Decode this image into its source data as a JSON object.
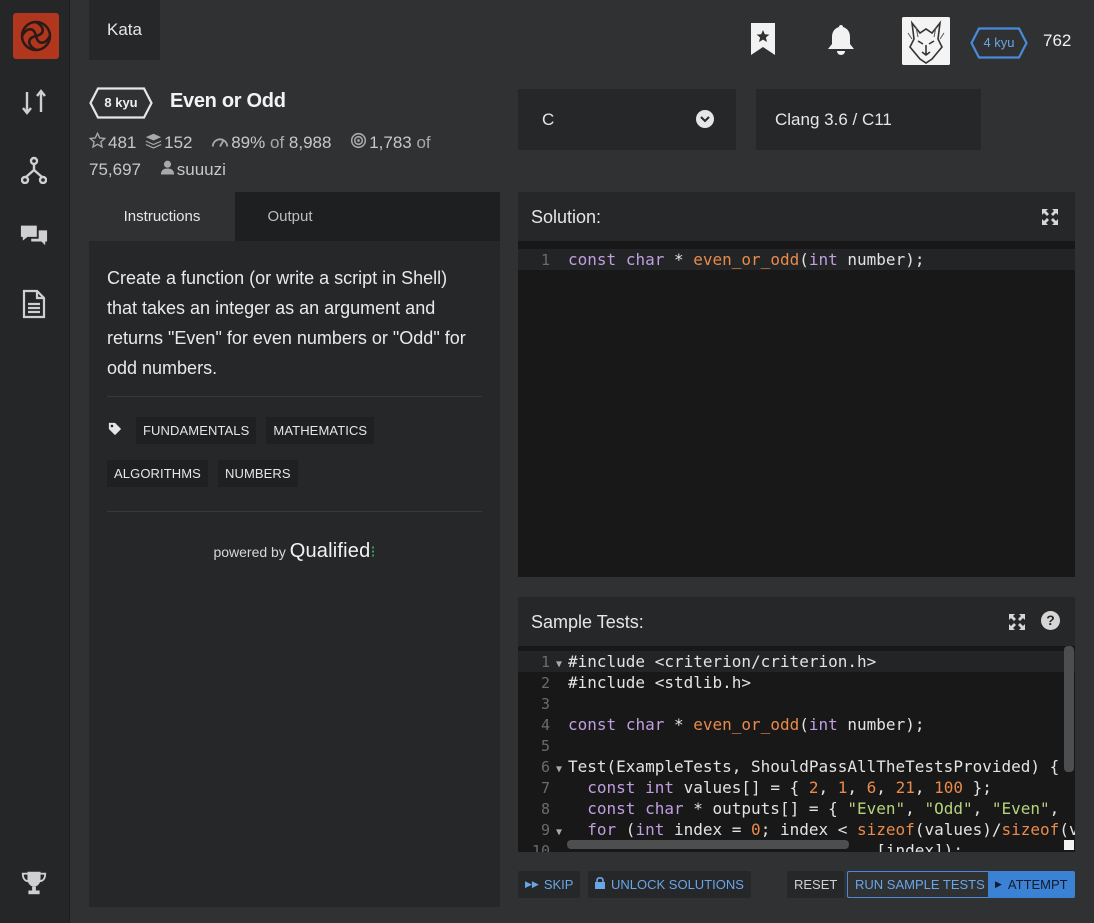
{
  "app": {
    "accent": "#b1361e",
    "link_color": "#6aa5e6"
  },
  "nav": {
    "top_tab": "Kata",
    "rail_icons": [
      "codewars-logo",
      "swap-arrows-icon",
      "fork-icon",
      "chat-icon",
      "document-icon",
      "trophy-icon"
    ]
  },
  "user": {
    "rank": "4 kyu",
    "honor": "762"
  },
  "kata": {
    "rank": "8 kyu",
    "title": "Even or Odd",
    "stars": "481",
    "collections": "152",
    "satisfaction_pct": "89%",
    "satisfaction_of": "of",
    "satisfaction_votes": "8,988",
    "completed": "1,783",
    "completed_of": "of",
    "attempts": "75,697",
    "author": "suuuzi"
  },
  "selects": {
    "language": "C",
    "version": "Clang 3.6 / C11"
  },
  "tabs": [
    {
      "label": "Instructions"
    },
    {
      "label": "Output"
    }
  ],
  "description": "Create a function (or write a script in Shell) that takes an integer as an argument and returns \"Even\" for even numbers or \"Odd\" for odd numbers.",
  "tags": [
    "FUNDAMENTALS",
    "MATHEMATICS",
    "ALGORITHMS",
    "NUMBERS"
  ],
  "powered": {
    "prefix": "powered by",
    "brand": "Qualified"
  },
  "solution": {
    "title": "Solution:",
    "lines": [
      "1"
    ]
  },
  "tests": {
    "title": "Sample Tests:",
    "lines": [
      "1",
      "2",
      "3",
      "4",
      "5",
      "6",
      "7",
      "8",
      "9",
      "10"
    ]
  },
  "buttons": {
    "skip": "SKIP",
    "unlock": "UNLOCK SOLUTIONS",
    "reset": "RESET",
    "run": "RUN SAMPLE TESTS",
    "attempt": "ATTEMPT"
  }
}
